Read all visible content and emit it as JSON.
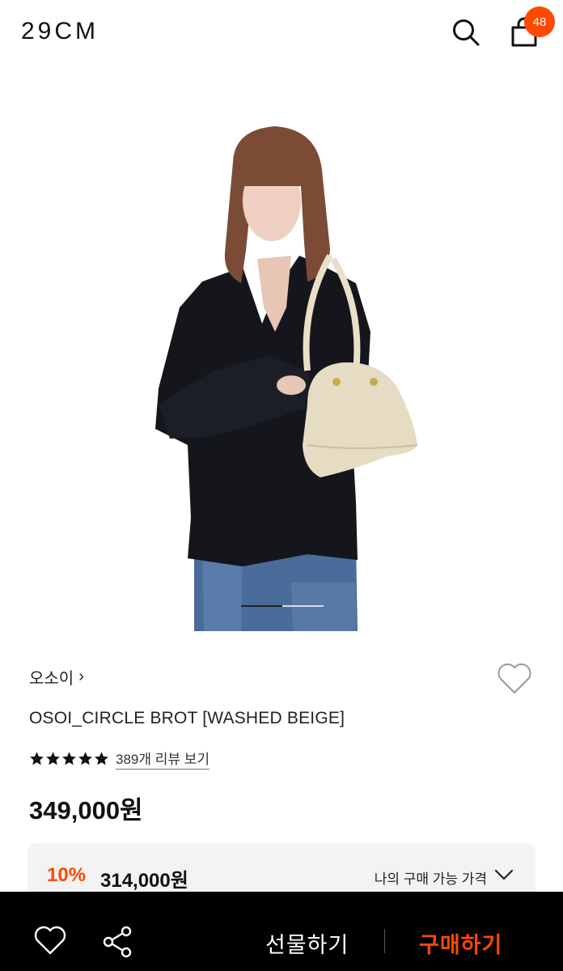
{
  "header": {
    "logo": "29CM",
    "cart_count": "48"
  },
  "hero": {
    "slider_progress": 0.5
  },
  "product": {
    "brand": "오소이",
    "brand_chevron": "›",
    "name": "OSOI_CIRCLE BROT [WASHED BEIGE]",
    "rating_stars": 5,
    "review_link": "389개 리뷰 보기",
    "price": "349,000원",
    "discount": {
      "rate": "10%",
      "price": "314,000원",
      "my_price_label": "나의 구매 가능 가격"
    }
  },
  "bottom_bar": {
    "gift_label": "선물하기",
    "buy_label": "구매하기"
  },
  "icons": {
    "search": "search-icon",
    "bag": "shopping-bag-icon",
    "heart": "heart-icon",
    "share": "share-icon",
    "chevron": "chevron-down-icon"
  },
  "colors": {
    "accent": "#ff4800",
    "bottom_bar": "#000000",
    "discount_box": "#f3f3f4"
  }
}
